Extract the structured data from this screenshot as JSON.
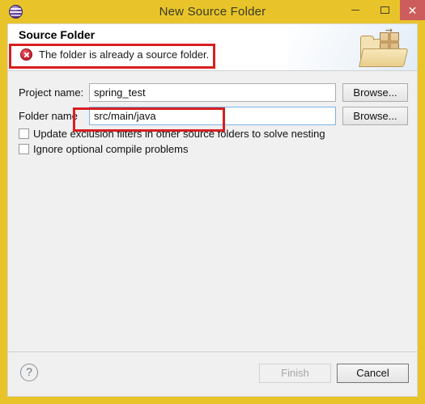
{
  "window": {
    "title": "New Source Folder",
    "app_icon": "eclipse-icon",
    "controls": {
      "minimize": "—",
      "maximize": "□",
      "close": "✕"
    },
    "titlebar_color": "#e8c42a",
    "close_button_color": "#cd5c5c"
  },
  "banner": {
    "title": "Source Folder",
    "message": "The folder is already a source folder.",
    "message_status": "error",
    "status_icon": "error-circle-icon",
    "graphic": "source-folder-package-icon"
  },
  "form": {
    "project": {
      "label": "Project name:",
      "value": "spring_test",
      "placeholder": "",
      "browse_label": "Browse..."
    },
    "folder": {
      "label": "Folder name",
      "value": "src/main/java",
      "placeholder": "",
      "browse_label": "Browse...",
      "focused": true
    },
    "checkboxes": [
      {
        "label": "Update exclusion filters in other source folders to solve nesting",
        "checked": false
      },
      {
        "label": "Ignore optional compile problems",
        "checked": false
      }
    ]
  },
  "footer": {
    "help_icon": "question-mark-icon",
    "help_glyph": "?",
    "finish_label": "Finish",
    "finish_enabled": false,
    "cancel_label": "Cancel",
    "cancel_enabled": true
  },
  "annotations": {
    "color": "#d81f22",
    "boxes": [
      {
        "name": "error-message-highlight"
      },
      {
        "name": "folder-name-highlight"
      }
    ]
  }
}
